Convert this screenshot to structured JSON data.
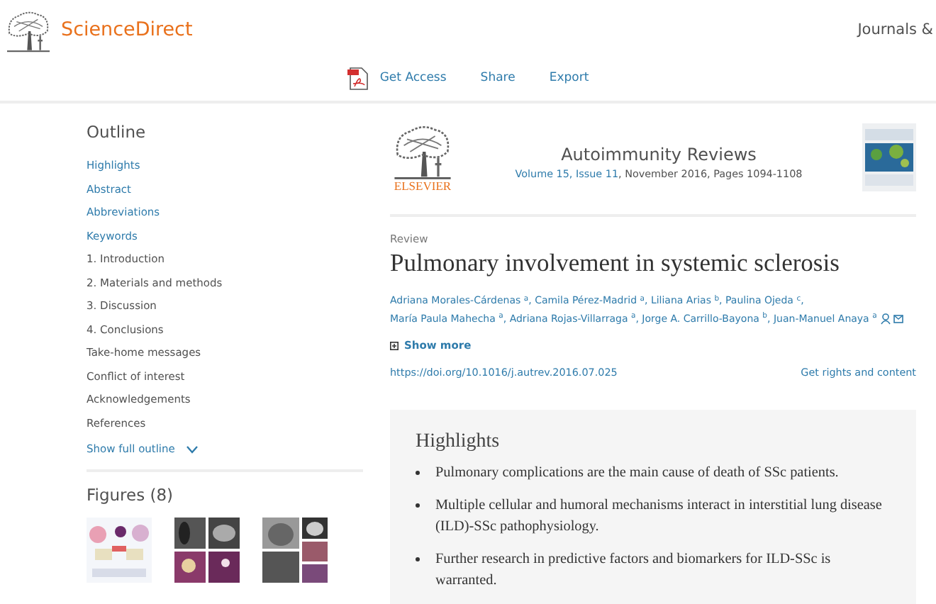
{
  "header": {
    "brand": "ScienceDirect",
    "nav_right": "Journals &"
  },
  "toolbar": [
    {
      "kind": "pdf",
      "label": "Get Access"
    },
    {
      "kind": "plain",
      "label": "Share"
    },
    {
      "kind": "plain",
      "label": "Export"
    }
  ],
  "outline": {
    "title": "Outline",
    "items": [
      {
        "label": "Highlights",
        "kind": "link"
      },
      {
        "label": "Abstract",
        "kind": "link"
      },
      {
        "label": "Abbreviations",
        "kind": "link"
      },
      {
        "label": "Keywords",
        "kind": "link"
      },
      {
        "label": "1. Introduction",
        "kind": "plain"
      },
      {
        "label": "2. Materials and methods",
        "kind": "plain"
      },
      {
        "label": "3. Discussion",
        "kind": "plain"
      },
      {
        "label": "4. Conclusions",
        "kind": "plain"
      },
      {
        "label": "Take-home messages",
        "kind": "plain"
      },
      {
        "label": "Conflict of interest",
        "kind": "plain"
      },
      {
        "label": "Acknowledgements",
        "kind": "plain"
      },
      {
        "label": "References",
        "kind": "plain"
      }
    ],
    "show_full": "Show full outline"
  },
  "figures": {
    "title": "Figures (8)"
  },
  "journal": {
    "publisher": "ELSEVIER",
    "name": "Autoimmunity Reviews",
    "issue_link": "Volume 15, Issue 11",
    "issue_rest": ", November 2016, Pages 1094-1108"
  },
  "article": {
    "type": "Review",
    "title": "Pulmonary involvement in systemic sclerosis",
    "authors": [
      {
        "name": "Adriana Morales-Cárdenas $^{a}$,"
      },
      {
        "name": "Camila Pérez-Madrid $^{a}$,"
      },
      {
        "name": "Liliana Arias $^{b}$,"
      },
      {
        "name": "Paulina Ojeda $^{c}$,"
      },
      {
        "name": "María Paula Mahecha $^{a}$,"
      },
      {
        "name": "Adriana Rojas-Villarraga $^{a}$,"
      },
      {
        "name": "Jorge A. Carrillo-Bayona $^{b}$,"
      },
      {
        "name": "Juan-Manuel Anaya $^{a}$"
      }
    ],
    "show_more": "Show more",
    "doi": "https://doi.org/10.1016/j.autrev.2016.07.025",
    "rights": "Get rights and content"
  },
  "highlights": {
    "title": "Highlights",
    "items": [
      "Pulmonary complications are the main cause of death of SSc patients.",
      "Multiple cellular and humoral mechanisms interact in interstitial lung disease (ILD)-SSc pathophysiology.",
      "Further research in predictive factors and biomarkers for ILD-SSc is warranted."
    ]
  }
}
